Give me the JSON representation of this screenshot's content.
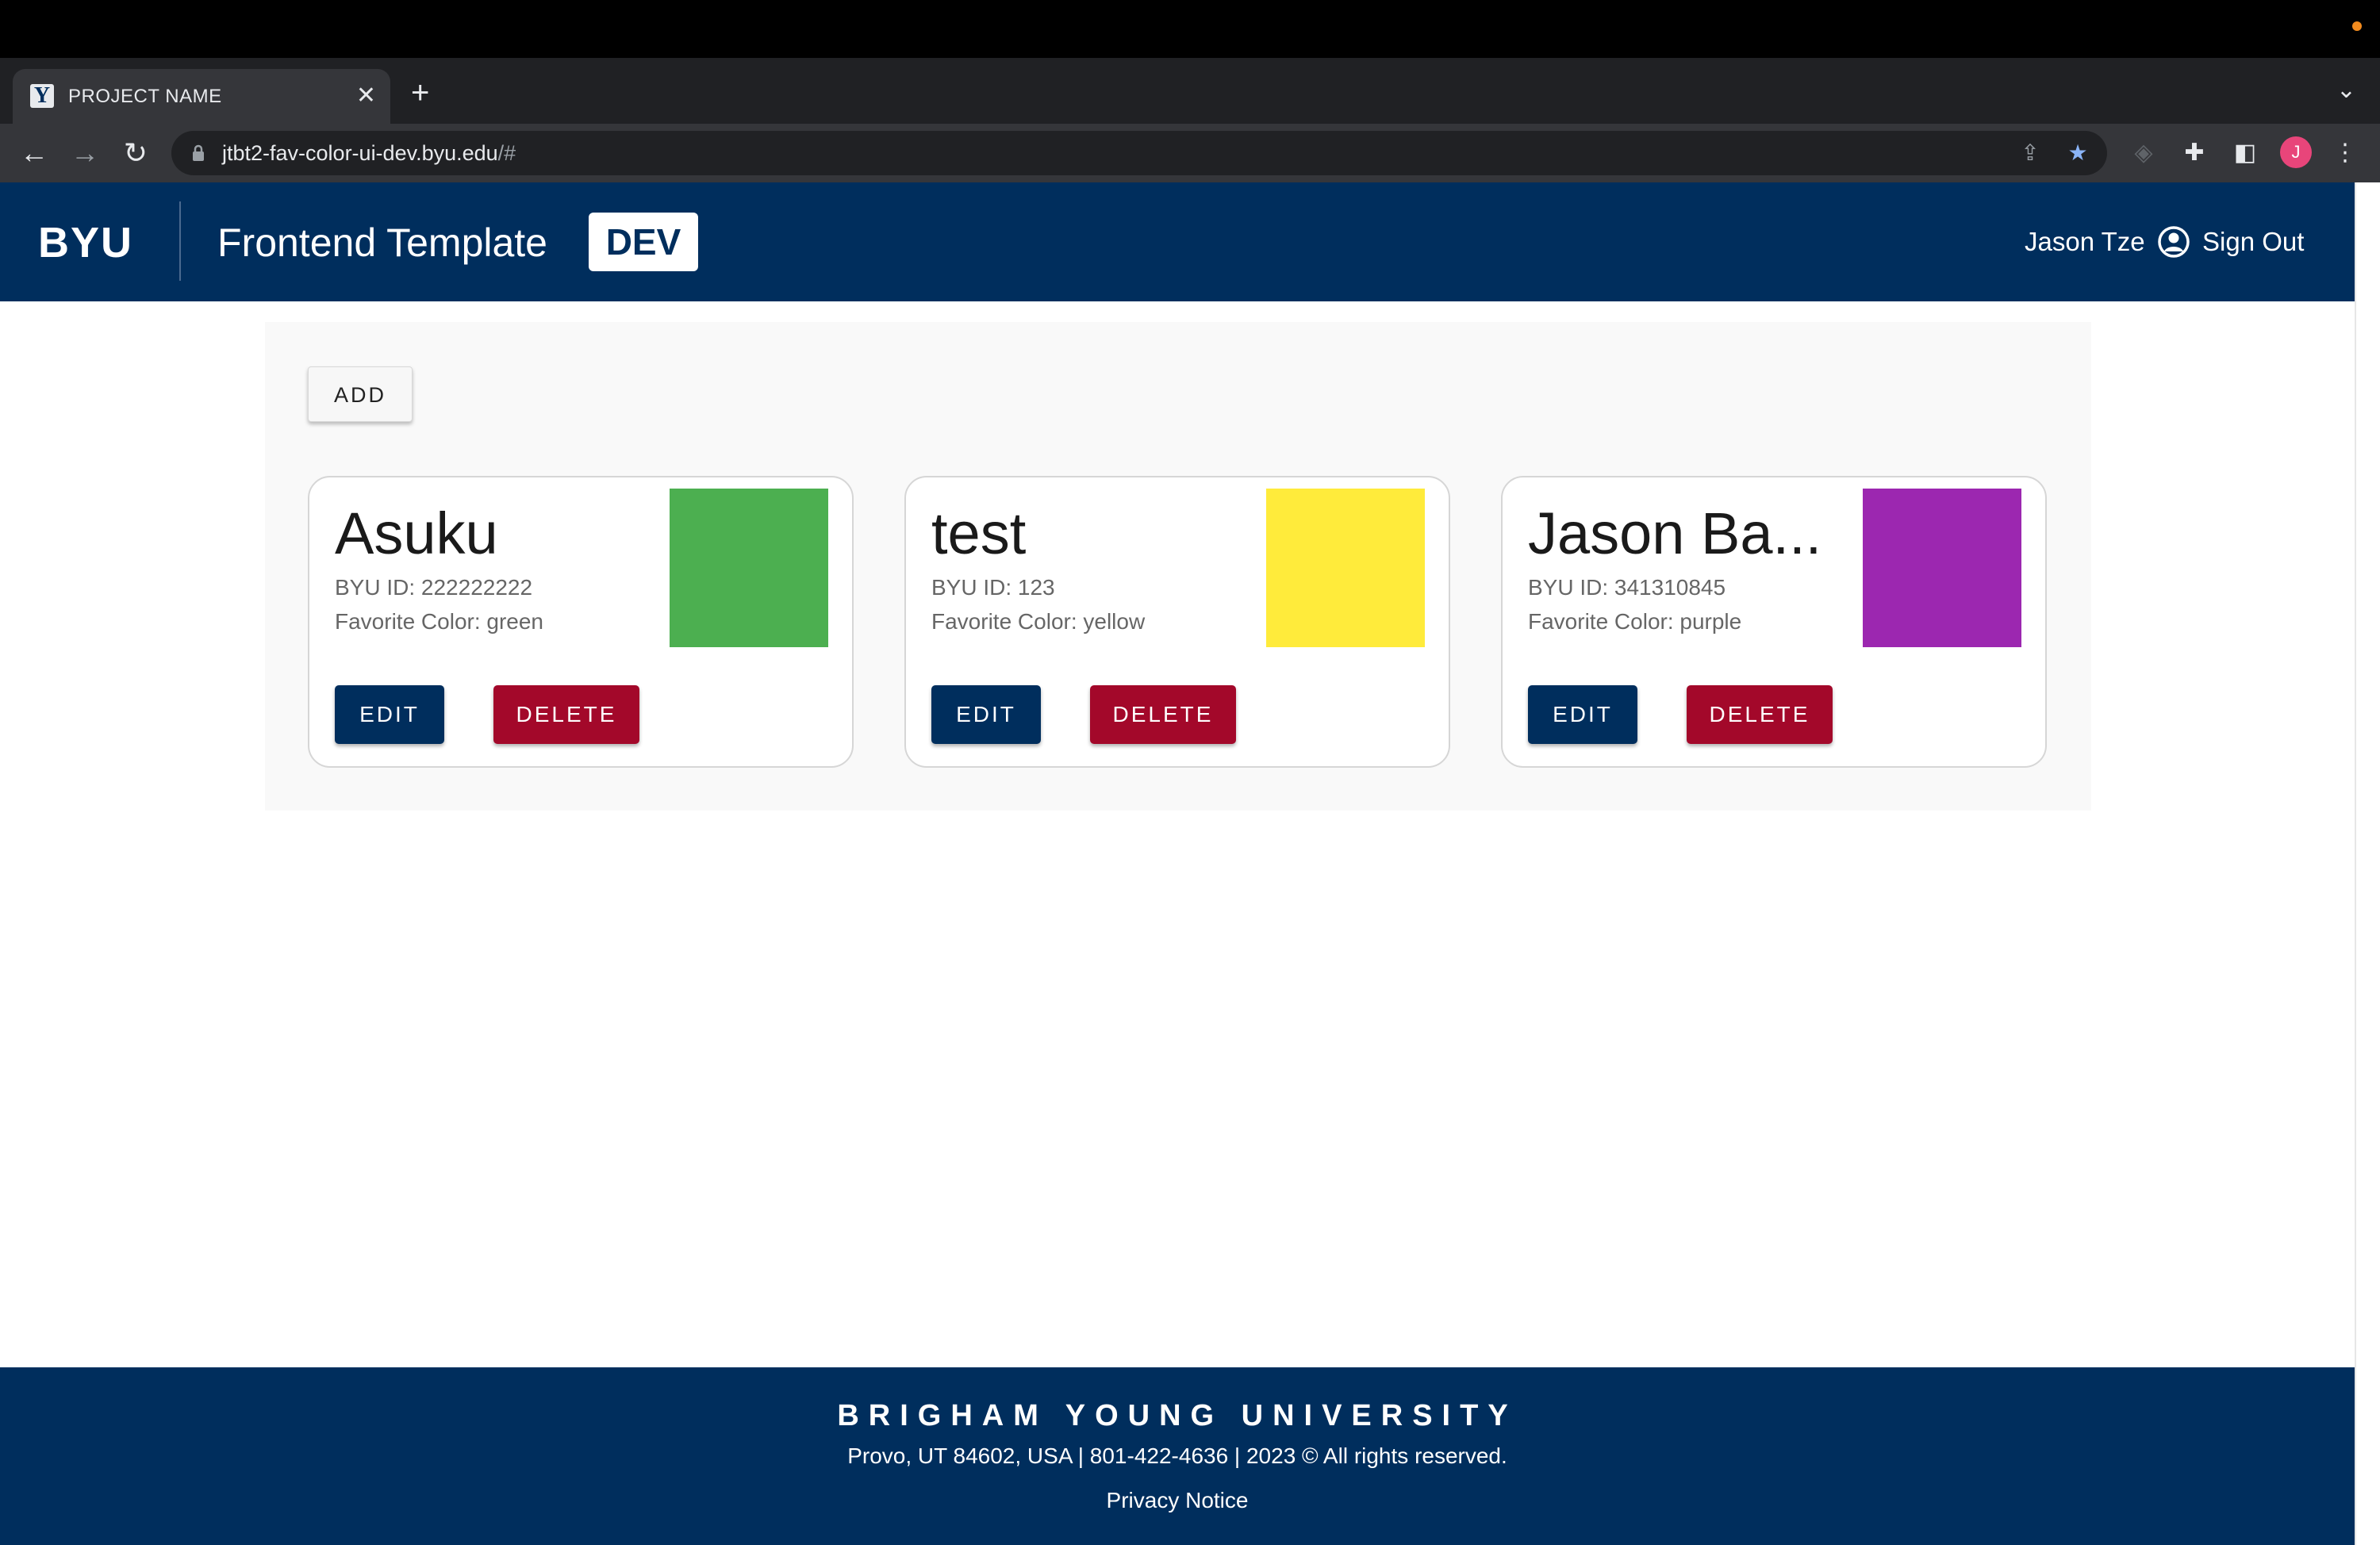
{
  "browser": {
    "tab_title": "PROJECT NAME",
    "tab_favicon": "Y",
    "url_main": "jtbt2-fav-color-ui-dev.byu.edu",
    "url_rest": "/#",
    "profile_initial": "J"
  },
  "header": {
    "logo": "BYU",
    "title": "Frontend Template",
    "env_badge": "DEV",
    "user_name": "Jason Tze",
    "sign_out_label": "Sign Out"
  },
  "main": {
    "add_label": "ADD",
    "cards": [
      {
        "name": "Asuku",
        "byu_id": "BYU ID: 222222222",
        "favorite_color": "Favorite Color: green",
        "swatch_color": "#4caf50",
        "edit_label": "EDIT",
        "delete_label": "DELETE"
      },
      {
        "name": "test",
        "byu_id": "BYU ID: 123",
        "favorite_color": "Favorite Color: yellow",
        "swatch_color": "#ffeb3b",
        "edit_label": "EDIT",
        "delete_label": "DELETE"
      },
      {
        "name": "Jason Ba...",
        "byu_id": "BYU ID: 341310845",
        "favorite_color": "Favorite Color: purple",
        "swatch_color": "#9c27b0",
        "edit_label": "EDIT",
        "delete_label": "DELETE"
      }
    ]
  },
  "footer": {
    "title": "BRIGHAM YOUNG UNIVERSITY",
    "address": "Provo, UT 84602, USA | 801-422-4636 | 2023 © All rights reserved.",
    "privacy": "Privacy Notice"
  },
  "colors": {
    "brand_navy": "#002e5d",
    "delete_red": "#a3082a"
  }
}
